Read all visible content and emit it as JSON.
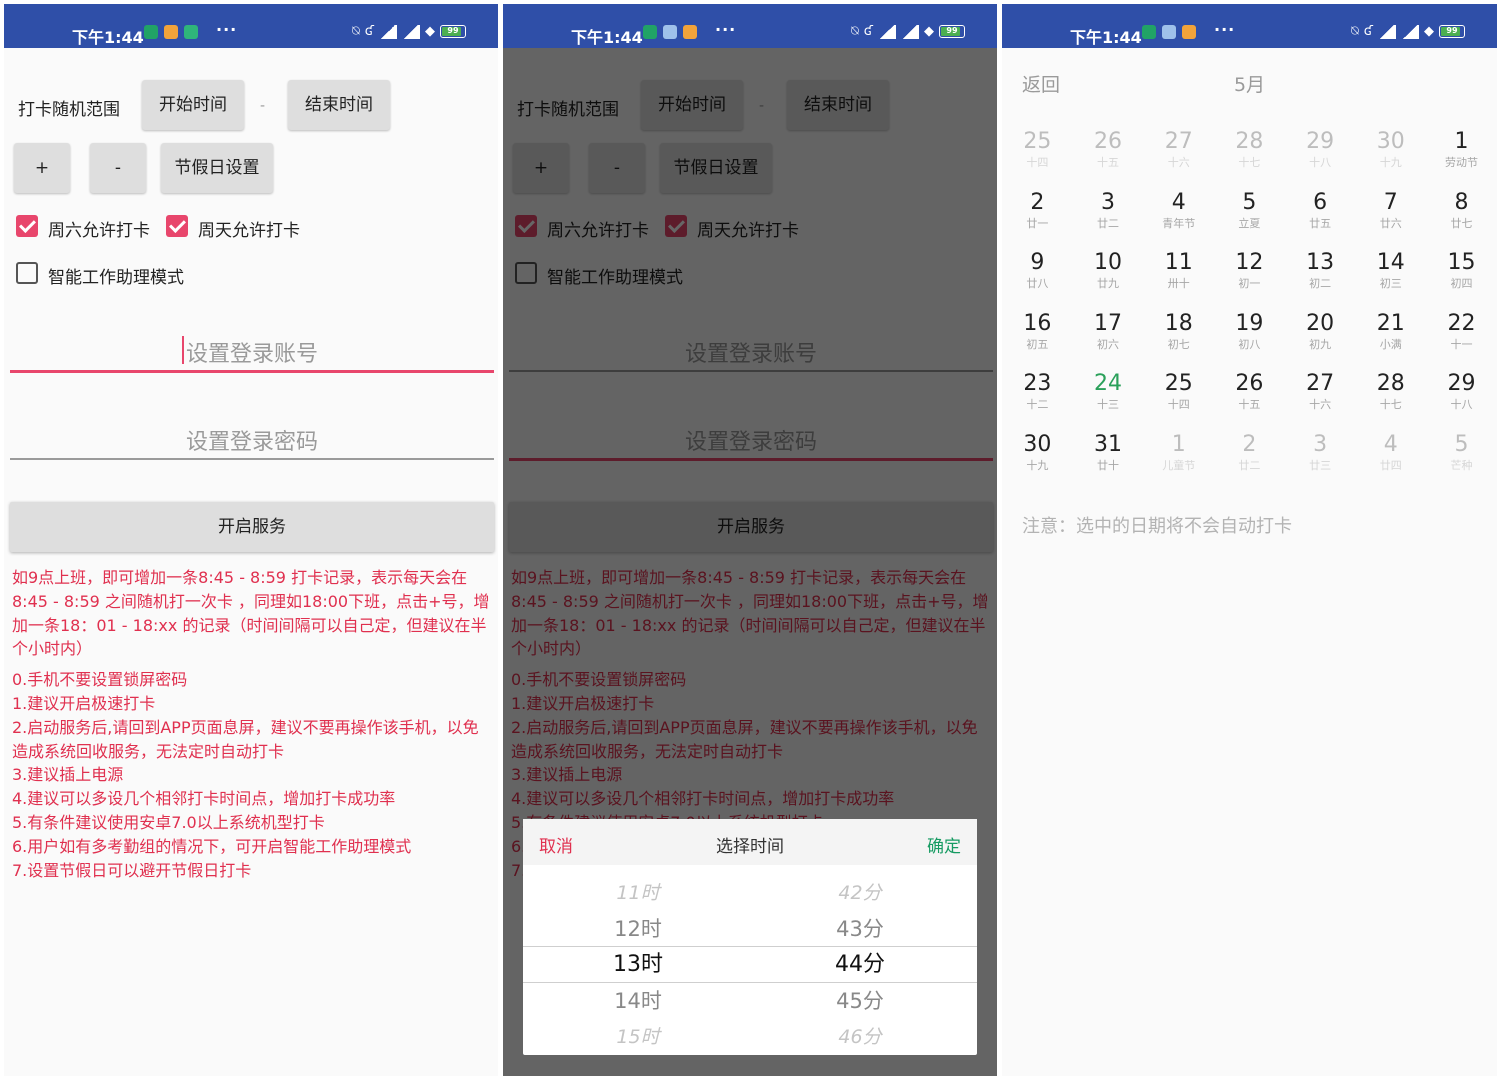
{
  "status": {
    "time": "下午1:44",
    "battery": "99",
    "dots": "···",
    "sys_icons": [
      "alarm-off-icon",
      "nfc-icon",
      "signal-icon",
      "hd-signal-icon",
      "wifi-icon",
      "battery-icon"
    ]
  },
  "colors": {
    "statusbar": "#2f4fa8",
    "accent": "#e8466c",
    "info_text": "#e0304f",
    "confirm": "#169b62",
    "today": "#2aa05a"
  },
  "settings": {
    "range_label": "打卡随机范围",
    "start_button": "开始时间",
    "range_sep": "-",
    "end_button": "结束时间",
    "plus": "+",
    "minus": "-",
    "holiday_button": "节假日设置",
    "saturday_checkbox": "周六允许打卡",
    "sunday_checkbox": "周天允许打卡",
    "smart_mode_checkbox": "智能工作助理模式",
    "account_placeholder": "设置登录账号",
    "password_placeholder": "设置登录密码",
    "service_button": "开启服务",
    "intro": "如9点上班，即可增加一条8:45 - 8:59 打卡记录，表示每天会在8:45 - 8:59 之间随机打一次卡 ，同理如18:00下班，点击+号，增加一条18：01 - 18:xx 的记录（时间间隔可以自己定，但建议在半个小时内）",
    "tips": [
      "0.手机不要设置锁屏密码",
      "1.建议开启极速打卡",
      "2.启动服务后,请回到APP页面息屏，建议不要再操作该手机，以免造成系统回收服务，无法定时自动打卡",
      "3.建议插上电源",
      "4.建议可以多设几个相邻打卡时间点，增加打卡成功率",
      "5.有条件建议使用安卓7.0以上系统机型打卡",
      "6.用户如有多考勤组的情况下，可开启智能工作助理模式",
      "7.设置节假日可以避开节假日打卡"
    ]
  },
  "picker": {
    "cancel": "取消",
    "title": "选择时间",
    "confirm": "确定",
    "hours": [
      "11时",
      "12时",
      "13时",
      "14时",
      "15时"
    ],
    "minutes": [
      "42分",
      "43分",
      "44分",
      "45分",
      "46分"
    ]
  },
  "calendar": {
    "back": "返回",
    "month": "5月",
    "note": "注意：选中的日期将不会自动打卡",
    "days": [
      {
        "d": "25",
        "l": "十四",
        "out": true
      },
      {
        "d": "26",
        "l": "十五",
        "out": true
      },
      {
        "d": "27",
        "l": "十六",
        "out": true
      },
      {
        "d": "28",
        "l": "十七",
        "out": true
      },
      {
        "d": "29",
        "l": "十八",
        "out": true
      },
      {
        "d": "30",
        "l": "十九",
        "out": true
      },
      {
        "d": "1",
        "l": "劳动节"
      },
      {
        "d": "2",
        "l": "廿一"
      },
      {
        "d": "3",
        "l": "廿二"
      },
      {
        "d": "4",
        "l": "青年节"
      },
      {
        "d": "5",
        "l": "立夏"
      },
      {
        "d": "6",
        "l": "廿五"
      },
      {
        "d": "7",
        "l": "廿六"
      },
      {
        "d": "8",
        "l": "廿七"
      },
      {
        "d": "9",
        "l": "廿八"
      },
      {
        "d": "10",
        "l": "廿九"
      },
      {
        "d": "11",
        "l": "卅十"
      },
      {
        "d": "12",
        "l": "初一"
      },
      {
        "d": "13",
        "l": "初二"
      },
      {
        "d": "14",
        "l": "初三"
      },
      {
        "d": "15",
        "l": "初四"
      },
      {
        "d": "16",
        "l": "初五"
      },
      {
        "d": "17",
        "l": "初六"
      },
      {
        "d": "18",
        "l": "初七"
      },
      {
        "d": "19",
        "l": "初八"
      },
      {
        "d": "20",
        "l": "初九"
      },
      {
        "d": "21",
        "l": "小满"
      },
      {
        "d": "22",
        "l": "十一"
      },
      {
        "d": "23",
        "l": "十二"
      },
      {
        "d": "24",
        "l": "十三",
        "today": true
      },
      {
        "d": "25",
        "l": "十四"
      },
      {
        "d": "26",
        "l": "十五"
      },
      {
        "d": "27",
        "l": "十六"
      },
      {
        "d": "28",
        "l": "十七"
      },
      {
        "d": "29",
        "l": "十八"
      },
      {
        "d": "30",
        "l": "十九"
      },
      {
        "d": "31",
        "l": "廿十"
      },
      {
        "d": "1",
        "l": "儿童节",
        "out": true
      },
      {
        "d": "2",
        "l": "廿二",
        "out": true
      },
      {
        "d": "3",
        "l": "廿三",
        "out": true
      },
      {
        "d": "4",
        "l": "廿四",
        "out": true
      },
      {
        "d": "5",
        "l": "芒种",
        "out": true
      }
    ]
  }
}
